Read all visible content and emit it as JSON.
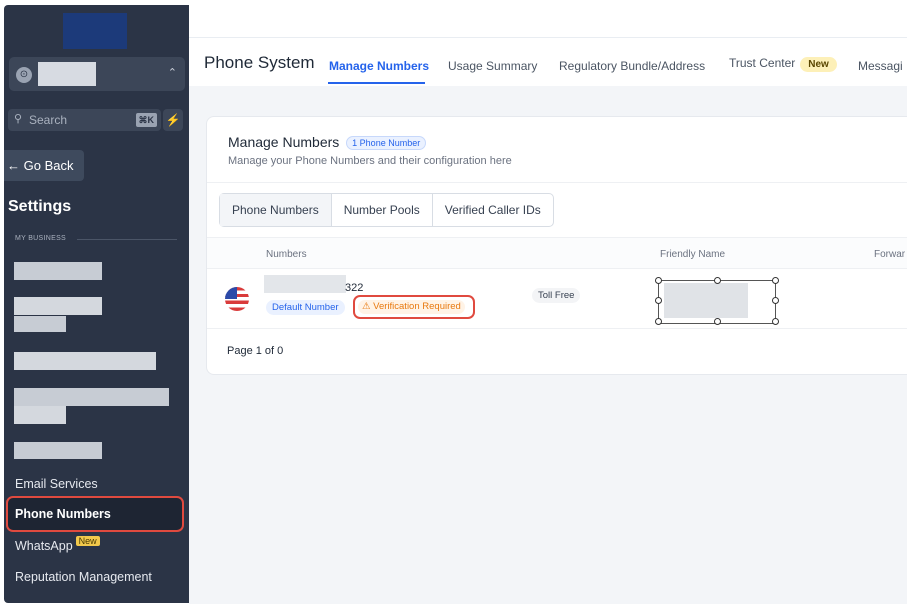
{
  "sidebar": {
    "search_label": "Search",
    "search_shortcut": "⌘K",
    "go_back": "← Go Back",
    "settings_title": "Settings",
    "section_label": "MY BUSINESS",
    "items": [
      {
        "label": "Email Services"
      },
      {
        "label": "Phone Numbers"
      },
      {
        "label": "WhatsApp",
        "badge": "New"
      },
      {
        "label": "Reputation Management"
      }
    ],
    "active_item": "Phone Numbers"
  },
  "header": {
    "title": "Phone System",
    "tabs": [
      {
        "label": "Manage Numbers"
      },
      {
        "label": "Usage Summary"
      },
      {
        "label": "Regulatory Bundle/Address"
      },
      {
        "label": "Trust Center",
        "badge": "New"
      },
      {
        "label": "Messagi"
      }
    ],
    "active_tab": "Manage Numbers"
  },
  "card": {
    "title": "Manage Numbers",
    "count_badge": "1 Phone Number",
    "subtitle": "Manage your Phone Numbers and their configuration here",
    "subtabs": [
      {
        "label": "Phone Numbers"
      },
      {
        "label": "Number Pools"
      },
      {
        "label": "Verified Caller IDs"
      }
    ],
    "active_subtab": "Phone Numbers",
    "columns": [
      "Numbers",
      "Friendly Name",
      "Forwar"
    ],
    "rows": [
      {
        "number_suffix": "322",
        "default_label": "Default Number",
        "status": "Verification Required",
        "type": "Toll Free"
      }
    ],
    "pagination": "Page 1 of 0"
  },
  "colors": {
    "sidebar_bg": "#2b3446",
    "accent": "#2563eb",
    "highlight": "#e04a3f",
    "warning": "#e8790f"
  }
}
